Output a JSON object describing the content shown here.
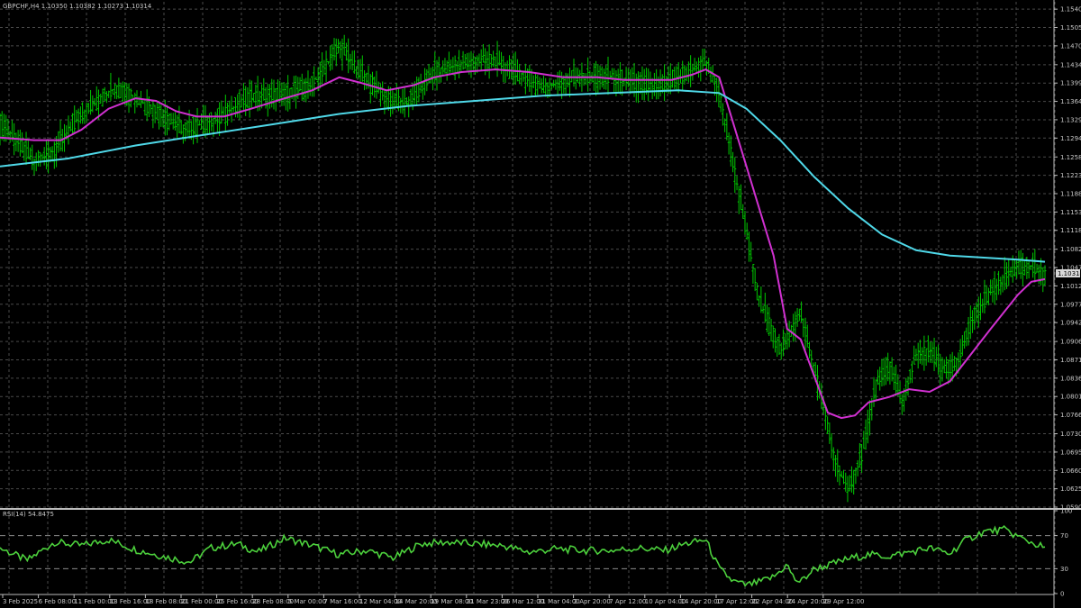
{
  "symbol_header": "GBPCHF,H4  1.10350 1.10382 1.10273 1.10314",
  "price_badge": "1.10314",
  "colors": {
    "background": "#000000",
    "grid": "#4a4a4a",
    "axis": "#bdbdbd",
    "candle": "#00c800",
    "ma_fast": "#d030d0",
    "ma_slow": "#4fd8e8",
    "rsi_line": "#4cd03c",
    "badge_bg": "#d9d9d9"
  },
  "chart_data": [
    {
      "type": "candlestick",
      "title": "GBPCHF,H4",
      "ylim": [
        1.059,
        1.1554
      ],
      "yticks": [
        "1.15400",
        "1.15050",
        "1.14700",
        "1.14340",
        "1.13990",
        "1.13640",
        "1.13290",
        "1.12940",
        "1.12580",
        "1.12230",
        "1.11880",
        "1.11530",
        "1.11180",
        "1.10820",
        "1.10470",
        "1.10120",
        "1.09770",
        "1.09420",
        "1.09060",
        "1.08710",
        "1.08360",
        "1.08010",
        "1.07660",
        "1.07300",
        "1.06950",
        "1.06600",
        "1.06250",
        "1.05900"
      ],
      "xticks": [
        "3 Feb 2025",
        "6 Feb 08:00",
        "11 Feb 00:00",
        "13 Feb 16:00",
        "18 Feb 08:00",
        "21 Feb 00:00",
        "25 Feb 16:00",
        "28 Feb 08:00",
        "5 Mar 00:00",
        "7 Mar 16:00",
        "12 Mar 04:00",
        "14 Mar 20:00",
        "19 Mar 08:00",
        "21 Mar 23:00",
        "26 Mar 12:00",
        "31 Mar 04:00",
        "2 Apr 20:00",
        "7 Apr 12:00",
        "10 Apr 04:00",
        "14 Apr 20:00",
        "17 Apr 12:00",
        "22 Apr 04:00",
        "24 Apr 20:00",
        "29 Apr 12:00"
      ],
      "last": {
        "open": 1.1035,
        "high": 1.10382,
        "low": 1.10273,
        "close": 1.10314
      },
      "price_path": [
        [
          0,
          1.1325
        ],
        [
          3,
          1.128
        ],
        [
          5,
          1.125
        ],
        [
          8,
          1.127
        ],
        [
          12,
          1.134
        ],
        [
          17,
          1.139
        ],
        [
          22,
          1.1355
        ],
        [
          27,
          1.131
        ],
        [
          32,
          1.133
        ],
        [
          37,
          1.1375
        ],
        [
          42,
          1.1375
        ],
        [
          46,
          1.1395
        ],
        [
          50,
          1.147
        ],
        [
          53,
          1.142
        ],
        [
          57,
          1.137
        ],
        [
          60,
          1.136
        ],
        [
          64,
          1.142
        ],
        [
          68,
          1.1435
        ],
        [
          72,
          1.1445
        ],
        [
          76,
          1.142
        ],
        [
          80,
          1.139
        ],
        [
          85,
          1.141
        ],
        [
          90,
          1.141
        ],
        [
          95,
          1.1395
        ],
        [
          98,
          1.1395
        ],
        [
          101,
          1.1415
        ],
        [
          104,
          1.144
        ],
        [
          106,
          1.138
        ],
        [
          109,
          1.118
        ],
        [
          112,
          1.098
        ],
        [
          115,
          1.089
        ],
        [
          118,
          1.096
        ],
        [
          121,
          1.08
        ],
        [
          123,
          1.068
        ],
        [
          125,
          1.062
        ],
        [
          127,
          1.069
        ],
        [
          129,
          1.082
        ],
        [
          131,
          1.086
        ],
        [
          133,
          1.079
        ],
        [
          135,
          1.088
        ],
        [
          137,
          1.089
        ],
        [
          139,
          1.085
        ],
        [
          141,
          1.086
        ],
        [
          143,
          1.094
        ],
        [
          146,
          1.1
        ],
        [
          149,
          1.104
        ],
        [
          152,
          1.105
        ],
        [
          154,
          1.1031
        ]
      ],
      "moving_averages": [
        {
          "points": [
            [
              0,
              1.1295
            ],
            [
              5,
              1.129
            ],
            [
              9,
              1.129
            ],
            [
              12,
              1.131
            ],
            [
              16,
              1.135
            ],
            [
              20,
              1.137
            ],
            [
              23,
              1.1365
            ],
            [
              26,
              1.1345
            ],
            [
              29,
              1.1335
            ],
            [
              33,
              1.1335
            ],
            [
              37,
              1.135
            ],
            [
              42,
              1.137
            ],
            [
              46,
              1.1385
            ],
            [
              50,
              1.141
            ],
            [
              53,
              1.14
            ],
            [
              57,
              1.1385
            ],
            [
              61,
              1.1395
            ],
            [
              64,
              1.141
            ],
            [
              68,
              1.142
            ],
            [
              73,
              1.1425
            ],
            [
              78,
              1.142
            ],
            [
              83,
              1.141
            ],
            [
              88,
              1.141
            ],
            [
              92,
              1.1405
            ],
            [
              96,
              1.1405
            ],
            [
              99,
              1.1405
            ],
            [
              102,
              1.1415
            ],
            [
              104,
              1.1425
            ],
            [
              106,
              1.141
            ],
            [
              110,
              1.124
            ],
            [
              114,
              1.107
            ],
            [
              116,
              1.093
            ],
            [
              118,
              1.091
            ],
            [
              120,
              1.084
            ],
            [
              122,
              1.077
            ],
            [
              124,
              1.076
            ],
            [
              126,
              1.0765
            ],
            [
              128,
              1.079
            ],
            [
              131,
              1.08
            ],
            [
              134,
              1.0815
            ],
            [
              137,
              1.081
            ],
            [
              140,
              1.083
            ],
            [
              143,
              1.088
            ],
            [
              146,
              1.093
            ],
            [
              150,
              1.0995
            ],
            [
              152,
              1.102
            ],
            [
              154,
              1.1025
            ]
          ]
        },
        {
          "points": [
            [
              0,
              1.124
            ],
            [
              10,
              1.1255
            ],
            [
              20,
              1.128
            ],
            [
              30,
              1.13
            ],
            [
              40,
              1.132
            ],
            [
              50,
              1.134
            ],
            [
              60,
              1.1355
            ],
            [
              70,
              1.1365
            ],
            [
              80,
              1.1375
            ],
            [
              90,
              1.138
            ],
            [
              100,
              1.1385
            ],
            [
              106,
              1.138
            ],
            [
              110,
              1.135
            ],
            [
              115,
              1.129
            ],
            [
              120,
              1.122
            ],
            [
              125,
              1.116
            ],
            [
              130,
              1.111
            ],
            [
              135,
              1.108
            ],
            [
              140,
              1.107
            ],
            [
              145,
              1.1066
            ],
            [
              150,
              1.1062
            ],
            [
              154,
              1.1058
            ]
          ]
        }
      ]
    },
    {
      "type": "line",
      "title": "RSI(14) 54.8475",
      "ylim": [
        0,
        100
      ],
      "yticks": [
        "100",
        "70",
        "30",
        "0"
      ],
      "levels": [
        70,
        30
      ],
      "values": [
        [
          0,
          55
        ],
        [
          4,
          40
        ],
        [
          8,
          62
        ],
        [
          12,
          58
        ],
        [
          16,
          65
        ],
        [
          20,
          53
        ],
        [
          24,
          45
        ],
        [
          28,
          38
        ],
        [
          31,
          55
        ],
        [
          35,
          60
        ],
        [
          38,
          50
        ],
        [
          42,
          67
        ],
        [
          46,
          58
        ],
        [
          50,
          47
        ],
        [
          54,
          52
        ],
        [
          58,
          43
        ],
        [
          62,
          60
        ],
        [
          66,
          62
        ],
        [
          70,
          60
        ],
        [
          74,
          58
        ],
        [
          78,
          50
        ],
        [
          82,
          54
        ],
        [
          86,
          52
        ],
        [
          90,
          52
        ],
        [
          94,
          55
        ],
        [
          98,
          52
        ],
        [
          101,
          60
        ],
        [
          104,
          65
        ],
        [
          106,
          30
        ],
        [
          108,
          15
        ],
        [
          110,
          10
        ],
        [
          112,
          14
        ],
        [
          114,
          20
        ],
        [
          116,
          35
        ],
        [
          117,
          18
        ],
        [
          118,
          14
        ],
        [
          120,
          30
        ],
        [
          122,
          34
        ],
        [
          125,
          42
        ],
        [
          128,
          47
        ],
        [
          131,
          45
        ],
        [
          134,
          50
        ],
        [
          137,
          55
        ],
        [
          140,
          48
        ],
        [
          142,
          63
        ],
        [
          145,
          75
        ],
        [
          148,
          77
        ],
        [
          151,
          65
        ],
        [
          154,
          55
        ]
      ]
    }
  ]
}
